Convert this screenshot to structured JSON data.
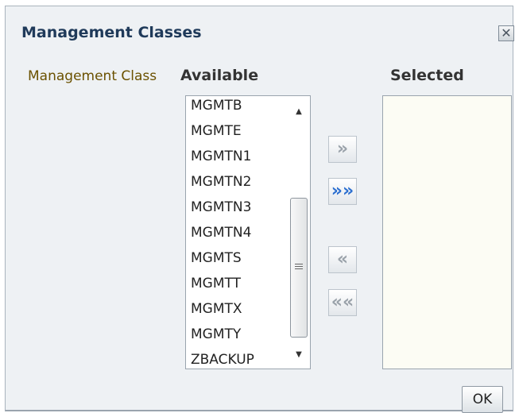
{
  "dialog": {
    "title": "Management Classes",
    "close_symbol": "✕",
    "icons": {
      "close": "close-icon",
      "move_right": "chevron-right-icon",
      "move_all_right": "double-chevron-right-icon",
      "move_left": "chevron-left-icon",
      "move_all_left": "double-chevron-left-icon"
    }
  },
  "field": {
    "label": "Management Class"
  },
  "available": {
    "header": "Available",
    "items": [
      "MGMTB",
      "MGMTE",
      "MGMTN1",
      "MGMTN2",
      "MGMTN3",
      "MGMTN4",
      "MGMTS",
      "MGMTT",
      "MGMTX",
      "MGMTY",
      "ZBACKUP"
    ]
  },
  "selected": {
    "header": "Selected",
    "items": []
  },
  "buttons": {
    "move_right": "»",
    "move_all_right": "»»",
    "move_left": "«",
    "move_all_left": "««",
    "ok": "OK"
  },
  "colors": {
    "title": "#1f3a5a",
    "label": "#6b5100",
    "active_button": "#2c6fd0",
    "disabled_button": "#9aa2aa",
    "dialog_bg": "#eef1f4"
  }
}
